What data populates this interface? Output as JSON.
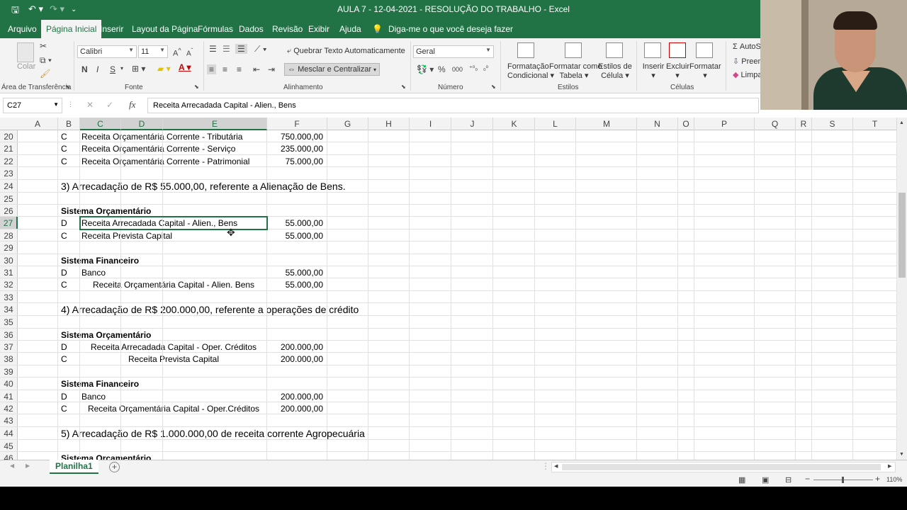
{
  "window": {
    "title": "AULA 7 - 12-04-2021 - RESOLUÇÃO DO TRABALHO  -  Excel"
  },
  "quick_access": {
    "save_icon": "save-icon",
    "undo_icon": "undo-icon",
    "redo_icon": "redo-icon"
  },
  "menu": {
    "tabs": [
      "Arquivo",
      "Página Inicial",
      "Inserir",
      "Layout da Página",
      "Fórmulas",
      "Dados",
      "Revisão",
      "Exibir",
      "Ajuda"
    ],
    "active_tab": "Página Inicial",
    "tell_me": "Diga-me o que você deseja fazer"
  },
  "ribbon": {
    "clipboard": {
      "paste": "Colar",
      "label": "Área de Transferência"
    },
    "font": {
      "name": "Calibri",
      "size": "11",
      "bold": "N",
      "italic": "I",
      "underline": "S",
      "label": "Fonte"
    },
    "alignment": {
      "wrap": "Quebrar Texto Automaticamente",
      "merge": "Mesclar e Centralizar",
      "label": "Alinhamento"
    },
    "number": {
      "format": "Geral",
      "percent": "%",
      "thousands": "000",
      "label": "Número"
    },
    "styles": {
      "conditional": [
        "Formatação",
        "Condicional"
      ],
      "as_table": [
        "Formatar como",
        "Tabela"
      ],
      "cell_styles": [
        "Estilos de",
        "Célula"
      ],
      "label": "Estilos"
    },
    "cells": {
      "insert": "Inserir",
      "delete": "Excluir",
      "format": "Formatar",
      "label": "Células"
    },
    "editing": {
      "autosum": "AutoS",
      "fill": "Preen",
      "clear": "Limpa"
    }
  },
  "formula_bar": {
    "name_box": "C27",
    "fx": "fx",
    "value": "Receita Arrecadada Capital - Alien., Bens"
  },
  "columns": [
    "A",
    "B",
    "C",
    "D",
    "E",
    "F",
    "G",
    "H",
    "I",
    "J",
    "K",
    "L",
    "M",
    "N",
    "O",
    "P",
    "Q",
    "R",
    "S",
    "T"
  ],
  "rows": [
    {
      "n": "20",
      "b": "C",
      "text": "Receita Orçamentária Corrente - Tributária",
      "f": "750.000,00"
    },
    {
      "n": "21",
      "b": "C",
      "text": "Receita Orçamentária Corrente - Serviço",
      "f": "235.000,00"
    },
    {
      "n": "22",
      "b": "C",
      "text": "Receita Orçamentária Corrente - Patrimonial",
      "f": "75.000,00"
    },
    {
      "n": "23"
    },
    {
      "n": "24",
      "heading": "3) Arrecadação de R$ 55.000,00, referente a Alienação de Bens."
    },
    {
      "n": "25"
    },
    {
      "n": "26",
      "bold": "Sistema Orçamentário"
    },
    {
      "n": "27",
      "b": "D",
      "text": "Receita Arrecadada Capital - Alien., Bens",
      "f": "55.000,00"
    },
    {
      "n": "28",
      "b": "C",
      "text": "Receita Prevista Capital",
      "f": "55.000,00"
    },
    {
      "n": "29"
    },
    {
      "n": "30",
      "bold": "Sistema Financeiro"
    },
    {
      "n": "31",
      "b": "D",
      "text": "Banco",
      "f": "55.000,00"
    },
    {
      "n": "32",
      "b": "C",
      "text": "Receita Orçamentária Capital - Alien. Bens",
      "f": "55.000,00"
    },
    {
      "n": "33"
    },
    {
      "n": "34",
      "heading": "4) Arrecadação de R$ 200.000,00, referente a operações de crédito"
    },
    {
      "n": "35"
    },
    {
      "n": "36",
      "bold": "Sistema Orçamentário"
    },
    {
      "n": "37",
      "b": "D",
      "text": "Receita Arrecadada Capital - Oper. Créditos",
      "f": "200.000,00"
    },
    {
      "n": "38",
      "b": "C",
      "text": "Receita Prevista Capital",
      "f": "200.000,00"
    },
    {
      "n": "39"
    },
    {
      "n": "40",
      "bold": "Sistema Financeiro"
    },
    {
      "n": "41",
      "b": "D",
      "text": "Banco",
      "f": "200.000,00"
    },
    {
      "n": "42",
      "b": "C",
      "text": "Receita Orçamentária Capital - Oper.Créditos",
      "f": "200.000,00"
    },
    {
      "n": "43"
    },
    {
      "n": "44",
      "heading": "5) Arrecadação de R$ 1.000.000,00 de receita corrente Agropecuária"
    },
    {
      "n": "45"
    },
    {
      "n": "46",
      "bold": "Sistema Orçamentário"
    }
  ],
  "selection": {
    "row": "27",
    "cols": "C:E"
  },
  "sheet_tabs": {
    "active": "Planilha1",
    "add": "+"
  },
  "status": {
    "zoom": "110%"
  }
}
